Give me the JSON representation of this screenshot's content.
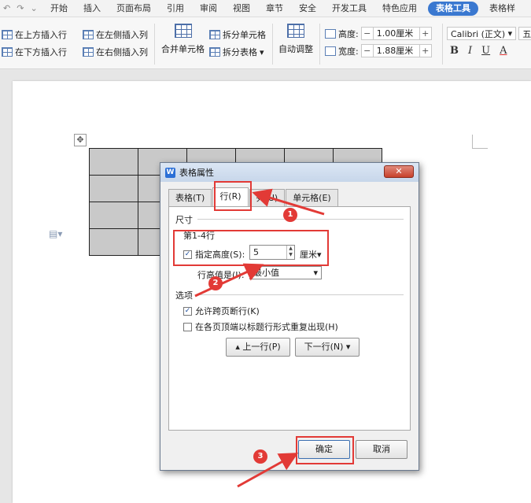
{
  "menubar": {
    "tabs": [
      "开始",
      "插入",
      "页面布局",
      "引用",
      "审阅",
      "视图",
      "章节",
      "安全",
      "开发工具",
      "特色应用",
      "表格工具",
      "表格样"
    ],
    "active": "表格工具"
  },
  "ribbon": {
    "insert_above": "在上方插入行",
    "insert_left": "在左侧插入列",
    "insert_below": "在下方插入行",
    "insert_right": "在右侧插入列",
    "merge_cells": "合并单元格",
    "split_cells": "拆分单元格",
    "split_table": "拆分表格",
    "auto_fit": "自动调整",
    "height_label": "高度:",
    "height_value": "1.00厘米",
    "width_label": "宽度:",
    "width_value": "1.88厘米",
    "font_name": "Calibri (正文)",
    "font_size": "五号",
    "bold": "B",
    "italic": "I",
    "underline": "U",
    "font_color": "A"
  },
  "dialog": {
    "title": "表格属性",
    "app_icon": "W",
    "close": "✕",
    "tabs": [
      "表格(T)",
      "行(R)",
      "列(U)",
      "单元格(E)"
    ],
    "selected_tab": "行(R)",
    "size_section": "尺寸",
    "rows_label": "第1-4行",
    "specify_height_label": "指定高度(S):",
    "specify_height_checked": true,
    "height_value": "5",
    "unit": "厘米",
    "row_height_is_label": "行高值是(I):",
    "row_height_is_value": "最小值",
    "options_section": "选项",
    "allow_break_label": "允许跨页断行(K)",
    "allow_break_checked": true,
    "repeat_header_label": "在各页顶端以标题行形式重复出现(H)",
    "repeat_header_checked": false,
    "prev_row_button": "上一行(P)",
    "next_row_button": "下一行(N)",
    "ok_button": "确定",
    "cancel_button": "取消"
  },
  "annotations": {
    "step1": "1",
    "step2": "2",
    "step3": "3",
    "highlight_color": "#e23a36"
  }
}
